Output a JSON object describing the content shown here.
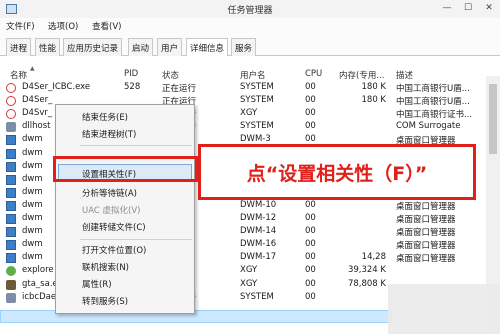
{
  "window": {
    "title": "任务管理器"
  },
  "menu": [
    "文件(F)",
    "选项(O)",
    "查看(V)"
  ],
  "tabs": [
    "进程",
    "性能",
    "应用历史记录",
    "启动",
    "用户",
    "详细信息",
    "服务"
  ],
  "active_tab": "详细信息",
  "grid": {
    "headers": {
      "name": "名称",
      "pid": "PID",
      "status": "状态",
      "user": "用户名",
      "cpu": "CPU",
      "memory": "内存(专用...",
      "desc": "描述"
    },
    "rows": [
      {
        "icon": "red-circle-icon",
        "name": "D4Ser_ICBC.exe",
        "pid": "528",
        "status": "正在运行",
        "user": "SYSTEM",
        "cpu": "00",
        "mem": "180 K",
        "desc": "中国工商银行U盾..."
      },
      {
        "icon": "red-circle-icon",
        "name": "D4Ser_",
        "pid": "",
        "status": "正在运行",
        "user": "SYSTEM",
        "cpu": "00",
        "mem": "180 K",
        "desc": "中国工商银行U盾..."
      },
      {
        "icon": "red-circle-icon",
        "name": "D4Svr_",
        "pid": "",
        "status": "正在运行",
        "user": "XGY",
        "cpu": "00",
        "mem": "",
        "desc": "中国工商银行证书..."
      },
      {
        "icon": "gear-icon",
        "name": "dllhost",
        "pid": "",
        "status": "正在运行",
        "user": "SYSTEM",
        "cpu": "00",
        "mem": "",
        "desc": "COM Surrogate"
      },
      {
        "icon": "window-icon",
        "name": "dwm",
        "pid": "",
        "status": "",
        "user": "DWM-3",
        "cpu": "00",
        "mem": "",
        "desc": "桌面窗口管理器"
      },
      {
        "icon": "window-icon",
        "name": "dwm",
        "pid": "",
        "status": "",
        "user": "",
        "cpu": "",
        "mem": "",
        "desc": ""
      },
      {
        "icon": "window-icon",
        "name": "dwm",
        "pid": "",
        "status": "",
        "user": "",
        "cpu": "",
        "mem": "",
        "desc": ""
      },
      {
        "icon": "window-icon",
        "name": "dwm",
        "pid": "",
        "status": "",
        "user": "",
        "cpu": "",
        "mem": "",
        "desc": ""
      },
      {
        "icon": "window-icon",
        "name": "dwm",
        "pid": "",
        "status": "",
        "user": "DWM-9",
        "cpu": "00",
        "mem": "",
        "desc": "桌面窗口管理器"
      },
      {
        "icon": "window-icon",
        "name": "dwm",
        "pid": "",
        "status": "",
        "user": "DWM-10",
        "cpu": "00",
        "mem": "",
        "desc": "桌面窗口管理器"
      },
      {
        "icon": "window-icon",
        "name": "dwm",
        "pid": "",
        "status": "",
        "user": "DWM-12",
        "cpu": "00",
        "mem": "",
        "desc": "桌面窗口管理器"
      },
      {
        "icon": "window-icon",
        "name": "dwm",
        "pid": "",
        "status": "",
        "user": "DWM-14",
        "cpu": "00",
        "mem": "",
        "desc": "桌面窗口管理器"
      },
      {
        "icon": "window-icon",
        "name": "dwm",
        "pid": "",
        "status": "",
        "user": "DWM-16",
        "cpu": "00",
        "mem": "",
        "desc": "桌面窗口管理器"
      },
      {
        "icon": "window-icon",
        "name": "dwm",
        "pid": "",
        "status": "",
        "user": "DWM-17",
        "cpu": "00",
        "mem": "14,28",
        "desc": "桌面窗口管理器"
      },
      {
        "icon": "globe-icon",
        "name": "explore",
        "pid": "",
        "status": "",
        "user": "XGY",
        "cpu": "00",
        "mem": "39,324 K",
        "desc": ""
      },
      {
        "icon": "gta-icon",
        "name": "gta_sa.exe",
        "pid": "",
        "status": "",
        "user": "XGY",
        "cpu": "00",
        "mem": "78,808 K",
        "desc": ""
      },
      {
        "icon": "gear-icon",
        "name": "icbcDaemon.exe",
        "pid": "376",
        "status": "正在运行",
        "user": "SYSTEM",
        "cpu": "00",
        "mem": "",
        "desc": ""
      }
    ]
  },
  "context_menu": [
    {
      "label": "结束任务(E)",
      "disabled": false
    },
    {
      "label": "结束进程树(T)",
      "disabled": false
    },
    {
      "label": "设置相关性(F)",
      "disabled": false,
      "highlighted": true
    },
    {
      "label": "分析等待链(A)",
      "disabled": false
    },
    {
      "label": "UAC 虚拟化(V)",
      "disabled": true
    },
    {
      "label": "创建转储文件(C)",
      "disabled": false
    },
    {
      "label": "打开文件位置(O)",
      "disabled": false
    },
    {
      "label": "联机搜索(N)",
      "disabled": false
    },
    {
      "label": "属性(R)",
      "disabled": false
    },
    {
      "label": "转到服务(S)",
      "disabled": false
    }
  ],
  "annotation": {
    "text": "点“设置相关性（F）”",
    "color": "#e0201a"
  }
}
